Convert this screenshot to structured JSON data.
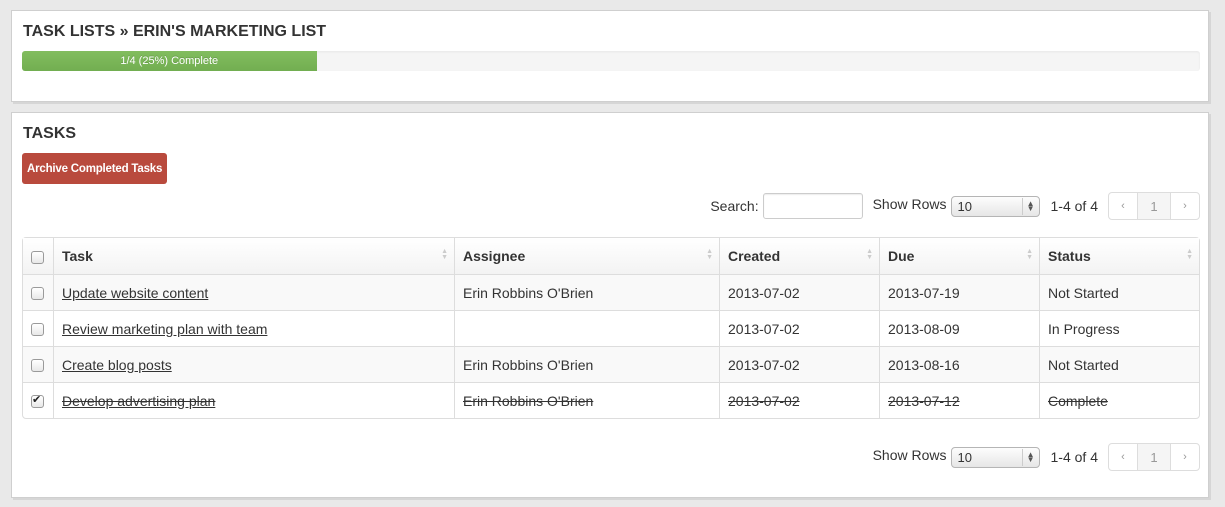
{
  "header": {
    "title": "TASK LISTS » ERIN'S MARKETING LIST",
    "progress": {
      "completed": 1,
      "total": 4,
      "percent": 25,
      "label": "1/4 (25%) Complete",
      "color": "#7ab658"
    }
  },
  "tasks_panel": {
    "title": "TASKS",
    "archive_button": "Archive Completed Tasks",
    "archive_color": "#b94a3d",
    "search_label": "Search:",
    "search_value": "",
    "show_rows_label": "Show Rows",
    "rows_value": "10",
    "range_text": "1-4 of 4",
    "pager": {
      "prev": "‹",
      "page": "1",
      "next": "›"
    }
  },
  "table": {
    "columns": [
      "Task",
      "Assignee",
      "Created",
      "Due",
      "Status"
    ],
    "rows": [
      {
        "checked": false,
        "task": "Update website content",
        "assignee": "Erin Robbins O'Brien",
        "created": "2013-07-02",
        "due": "2013-07-19",
        "status": "Not Started"
      },
      {
        "checked": false,
        "task": "Review marketing plan with team",
        "assignee": "",
        "created": "2013-07-02",
        "due": "2013-08-09",
        "status": "In Progress"
      },
      {
        "checked": false,
        "task": "Create blog posts",
        "assignee": "Erin Robbins O'Brien",
        "created": "2013-07-02",
        "due": "2013-08-16",
        "status": "Not Started"
      },
      {
        "checked": true,
        "task": "Develop advertising plan",
        "assignee": "Erin Robbins O'Brien",
        "created": "2013-07-02",
        "due": "2013-07-12",
        "status": "Complete"
      }
    ]
  }
}
